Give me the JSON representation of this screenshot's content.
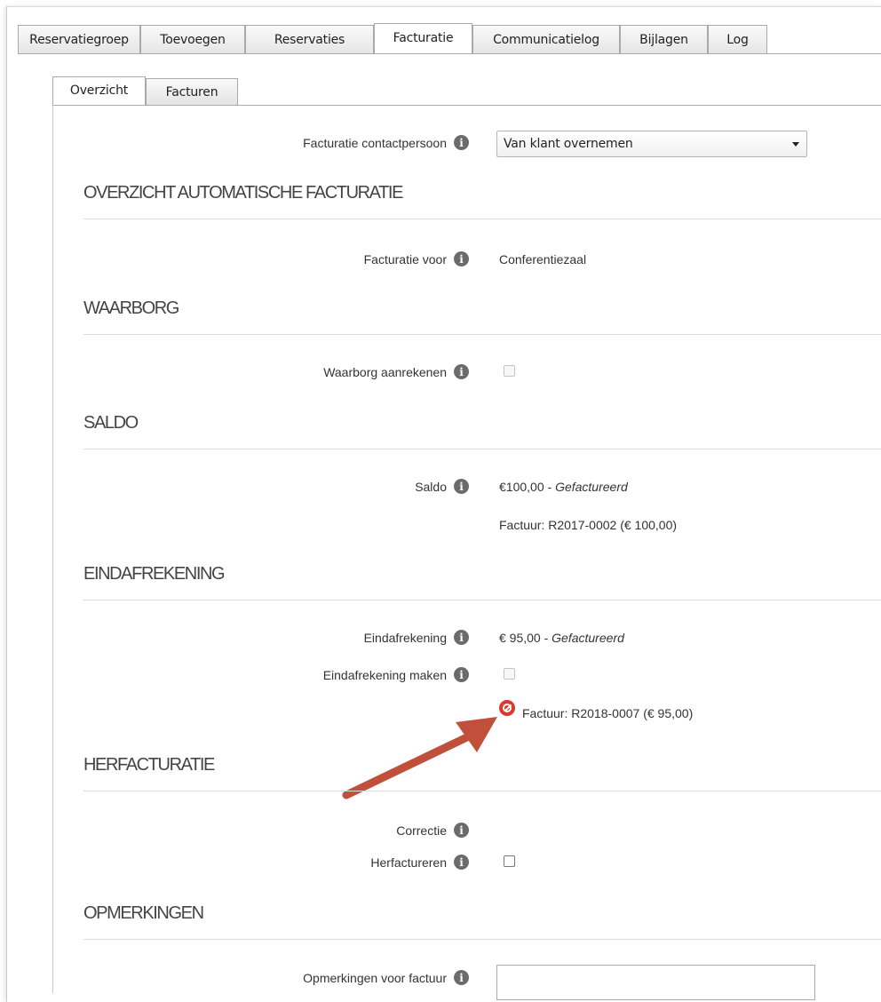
{
  "tabs_top": [
    {
      "label": "Reservatiegroep"
    },
    {
      "label": "Toevoegen"
    },
    {
      "label": "Reservaties"
    },
    {
      "label": "Facturatie",
      "active": true
    },
    {
      "label": "Communicatielog"
    },
    {
      "label": "Bijlagen"
    },
    {
      "label": "Log"
    }
  ],
  "tabs_sub": [
    {
      "label": "Overzicht",
      "active": true
    },
    {
      "label": "Facturen"
    }
  ],
  "contact": {
    "label": "Facturatie contactpersoon",
    "value": "Van klant overnemen"
  },
  "sections": {
    "auto": "OVERZICHT AUTOMATISCHE FACTURATIE",
    "waarborg": "WAARBORG",
    "saldo": "SALDO",
    "eind": "EINDAFREKENING",
    "herf": "HERFACTURATIE",
    "opm": "OPMERKINGEN"
  },
  "facturatie_voor": {
    "label": "Facturatie voor",
    "value": "Conferentiezaal"
  },
  "waarborg": {
    "label": "Waarborg aanrekenen",
    "checked": false,
    "disabled": true
  },
  "saldo": {
    "label": "Saldo",
    "amount": "€100,00 - ",
    "status": "Gefactureerd",
    "invoice": "Factuur: R2017-0002 (€ 100,00)"
  },
  "eindafrekening": {
    "label": "Eindafrekening",
    "amount": "€ 95,00 - ",
    "status": "Gefactureerd"
  },
  "eind_maken": {
    "label": "Eindafrekening maken",
    "checked": false,
    "disabled": true
  },
  "eind_invoice": {
    "text": "Factuur: R2018-0007 (€ 95,00)",
    "icon": "blocked-icon",
    "icon_color": "#d9382a"
  },
  "correctie": {
    "label": "Correctie"
  },
  "herfactureren": {
    "label": "Herfactureren",
    "checked": false
  },
  "opmerkingen": {
    "label": "Opmerkingen voor factuur",
    "value": ""
  },
  "annotation": {
    "color": "#c0503a"
  }
}
